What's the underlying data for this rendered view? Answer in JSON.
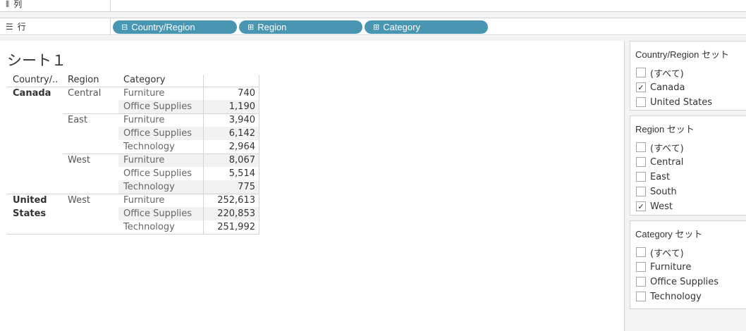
{
  "shelves": {
    "columns": {
      "icon": "columns-icon",
      "label": "列"
    },
    "rows": {
      "icon": "rows-icon",
      "label": "行",
      "pills": [
        {
          "label": "Country/Region",
          "icon": "collapse-icon",
          "glyph": "⊟"
        },
        {
          "label": "Region",
          "icon": "expand-icon",
          "glyph": "⊞"
        },
        {
          "label": "Category",
          "icon": "expand-icon",
          "glyph": "⊞"
        }
      ]
    }
  },
  "sheet": {
    "title": "シート１",
    "headers": {
      "country": "Country/..",
      "region": "Region",
      "category": "Category"
    },
    "rows": [
      {
        "country": "Canada",
        "region": "Central",
        "category": "Furniture",
        "value": "740"
      },
      {
        "country": "",
        "region": "",
        "category": "Office Supplies",
        "value": "1,190"
      },
      {
        "country": "",
        "region": "East",
        "category": "Furniture",
        "value": "3,940"
      },
      {
        "country": "",
        "region": "",
        "category": "Office Supplies",
        "value": "6,142"
      },
      {
        "country": "",
        "region": "",
        "category": "Technology",
        "value": "2,964"
      },
      {
        "country": "",
        "region": "West",
        "category": "Furniture",
        "value": "8,067"
      },
      {
        "country": "",
        "region": "",
        "category": "Office Supplies",
        "value": "5,514"
      },
      {
        "country": "",
        "region": "",
        "category": "Technology",
        "value": "775"
      },
      {
        "country": "United",
        "region": "West",
        "category": "Furniture",
        "value": "252,613"
      },
      {
        "country": "States",
        "region": "",
        "category": "Office Supplies",
        "value": "220,853"
      },
      {
        "country": "",
        "region": "",
        "category": "Technology",
        "value": "251,992"
      }
    ]
  },
  "filters": [
    {
      "title": "Country/Region セット",
      "items": [
        {
          "label": "(すべて)",
          "checked": false
        },
        {
          "label": "Canada",
          "checked": true
        },
        {
          "label": "United States",
          "checked": false
        }
      ]
    },
    {
      "title": "Region セット",
      "items": [
        {
          "label": "(すべて)",
          "checked": false
        },
        {
          "label": "Central",
          "checked": false
        },
        {
          "label": "East",
          "checked": false
        },
        {
          "label": "South",
          "checked": false
        },
        {
          "label": "West",
          "checked": true
        }
      ]
    },
    {
      "title": "Category セット",
      "items": [
        {
          "label": "(すべて)",
          "checked": false
        },
        {
          "label": "Furniture",
          "checked": false
        },
        {
          "label": "Office Supplies",
          "checked": false
        },
        {
          "label": "Technology",
          "checked": false
        }
      ]
    }
  ],
  "checkmark": "✓"
}
